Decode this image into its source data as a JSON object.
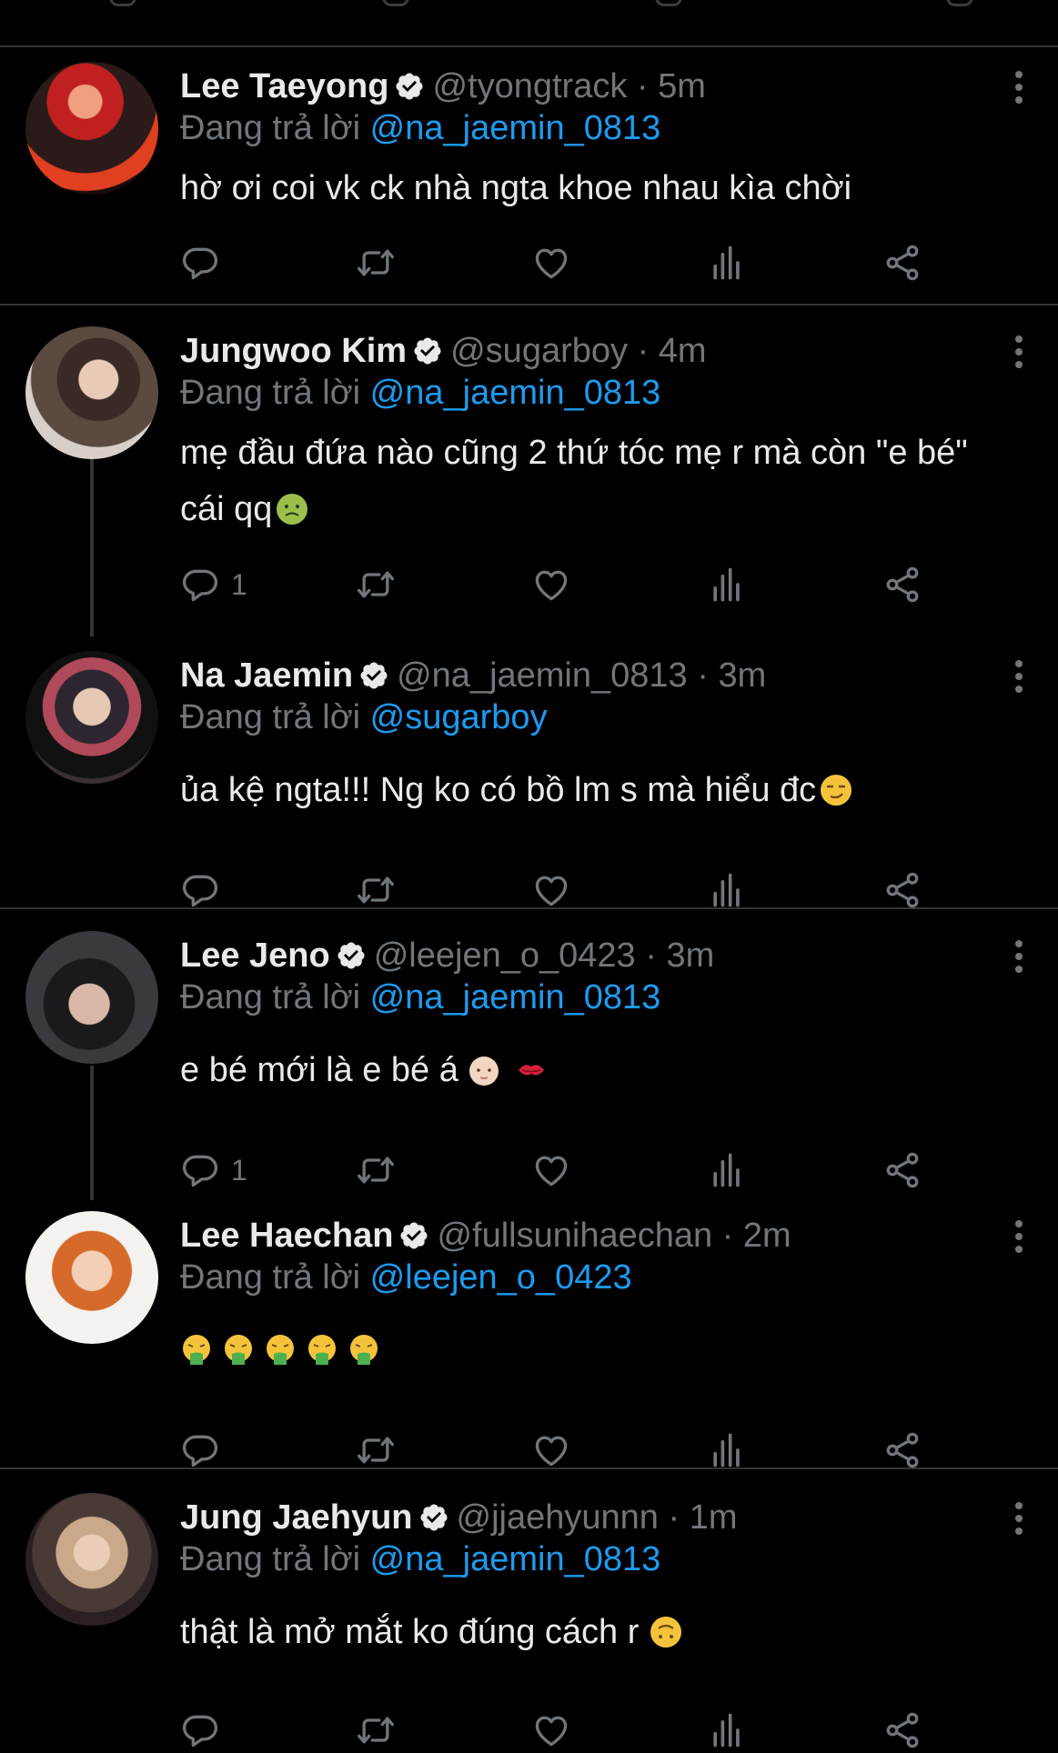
{
  "reply_prefix": "Đang trả lời",
  "tweets": [
    {
      "name": "Lee Taeyong",
      "handle": "@tyongtrack",
      "time": "5m",
      "reply_to": "@na_jaemin_0813",
      "text": "hờ ơi coi vk ck nhà ngta khoe nhau kìa chời",
      "reply_count": ""
    },
    {
      "name": "Jungwoo Kim",
      "handle": "@sugarboy",
      "time": "4m",
      "reply_to": "@na_jaemin_0813",
      "text": "mẹ đầu đứa nào cũng 2 thứ tóc mẹ r mà còn \"e bé\" cái qq",
      "reply_count": "1"
    },
    {
      "name": "Na Jaemin",
      "handle": "@na_jaemin_0813",
      "time": "3m",
      "reply_to": "@sugarboy",
      "text": "ủa kệ ngta!!! Ng ko có bồ lm s mà hiểu đc",
      "reply_count": ""
    },
    {
      "name": "Lee Jeno",
      "handle": "@leejen_o_0423",
      "time": "3m",
      "reply_to": "@na_jaemin_0813",
      "text": "e bé mới là e bé á",
      "reply_count": "1"
    },
    {
      "name": "Lee Haechan",
      "handle": "@fullsunihaechan",
      "time": "2m",
      "reply_to": "@leejen_o_0423",
      "text": "",
      "reply_count": ""
    },
    {
      "name": "Jung Jaehyun",
      "handle": "@jjaehyunnn",
      "time": "1m",
      "reply_to": "@na_jaemin_0813",
      "text": "thật là mở mắt ko đúng cách r",
      "reply_count": ""
    }
  ],
  "colors": {
    "background": "#000000",
    "text": "#e7e9ea",
    "muted": "#71767b",
    "mention": "#1d9bf0",
    "divider": "#2f3336",
    "verified": "#e7e9ea"
  },
  "icons": {
    "reply": "comment-icon",
    "retweet": "retweet-icon",
    "like": "heart-icon",
    "views": "analytics-icon",
    "share": "share-icon",
    "more": "more-icon",
    "verified": "verified-badge-icon"
  }
}
